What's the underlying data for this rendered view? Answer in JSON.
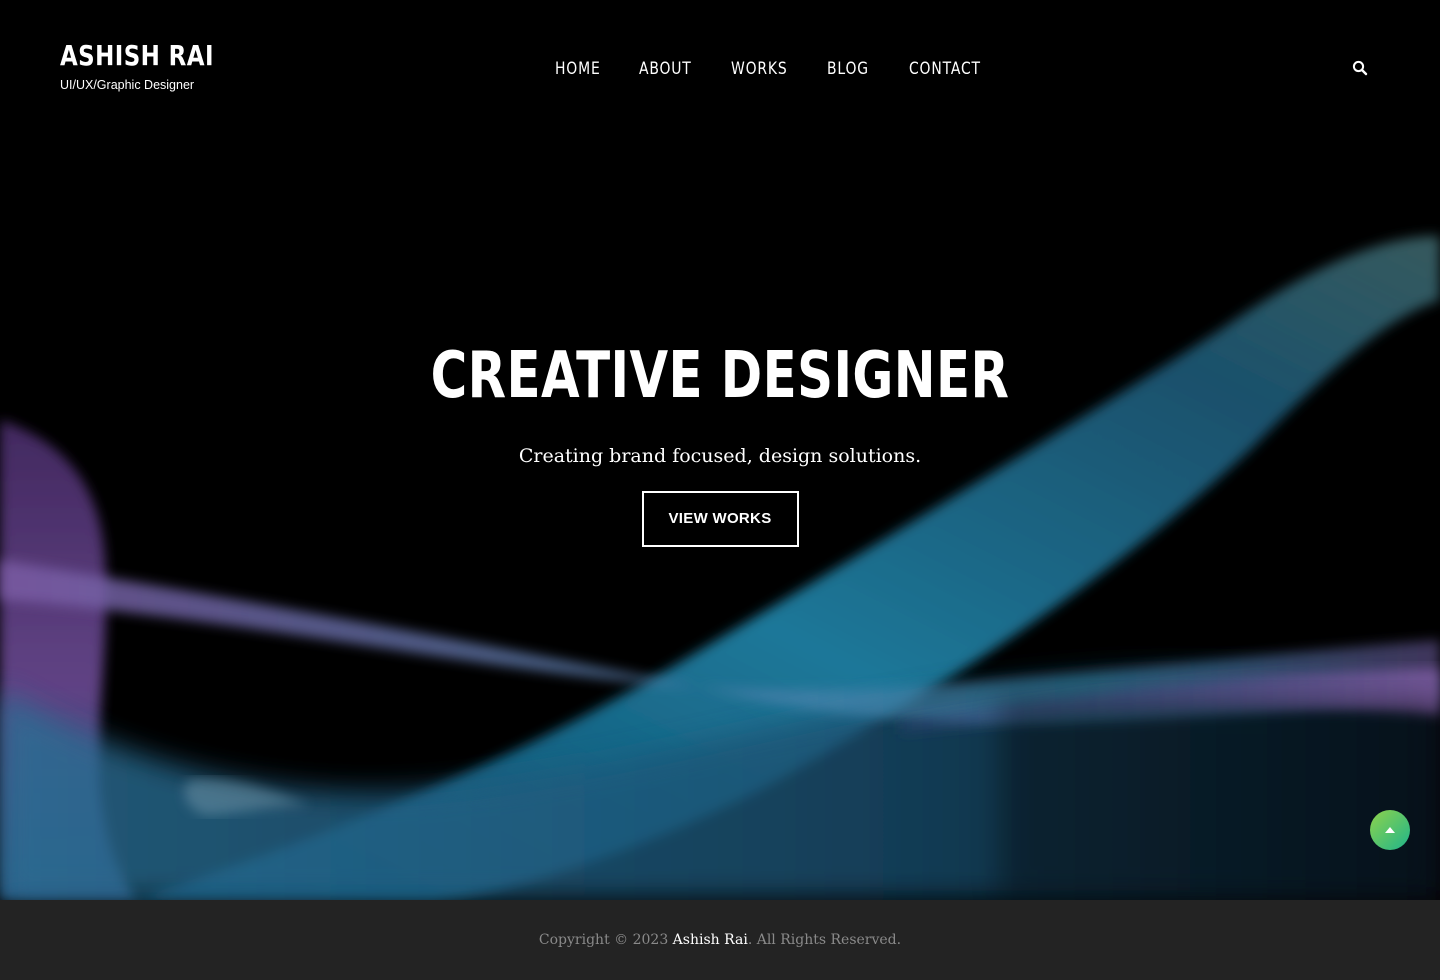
{
  "brand": {
    "title": "ASHISH RAI",
    "tagline": "UI/UX/Graphic Designer"
  },
  "nav": {
    "items": [
      {
        "label": "HOME"
      },
      {
        "label": "ABOUT"
      },
      {
        "label": "WORKS"
      },
      {
        "label": "BLOG"
      },
      {
        "label": "CONTACT"
      }
    ],
    "search_icon": "search-icon"
  },
  "hero": {
    "title": "CREATIVE DESIGNER",
    "subtitle": "Creating brand focused, design solutions.",
    "cta_label": "VIEW WORKS",
    "wave_colors": {
      "purple": "#6b4a93",
      "teal": "#1e7ea1",
      "blue": "#2f5f8f"
    }
  },
  "back_to_top": {
    "icon": "caret-up-icon",
    "colors": {
      "start": "#8fd34b",
      "end": "#1fb58b"
    }
  },
  "footer": {
    "copyright_prefix": "Copyright © 2023 ",
    "author": "Ashish Rai",
    "copyright_suffix": ". All Rights Reserved.",
    "background": "#232323"
  }
}
